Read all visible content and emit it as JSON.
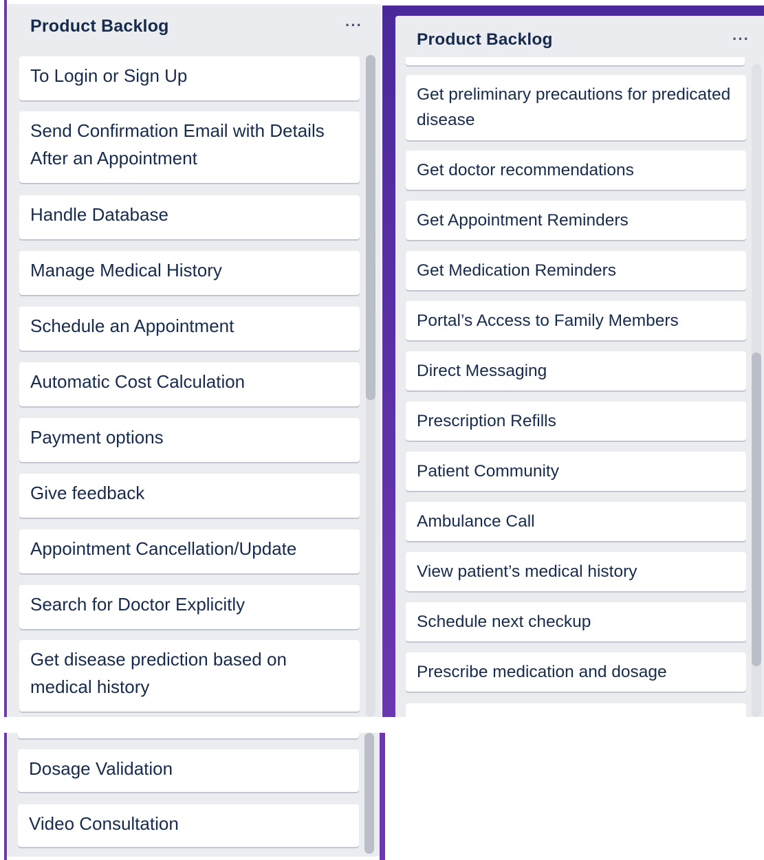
{
  "colors": {
    "board_purple_left": "#6d37ad",
    "board_purple_right": "#5b2fa6",
    "list_bg": "#ebecf0",
    "card_bg": "#ffffff",
    "text": "#172b4d"
  },
  "left_list": {
    "title": "Product Backlog",
    "menu_label": "···",
    "cards": [
      "To Login or Sign Up",
      "Send Confirmation Email with Details After an Appointment",
      "Handle Database",
      "Manage Medical History",
      "Schedule an Appointment",
      "Automatic Cost Calculation",
      "Payment options",
      "Give feedback",
      "Appointment Cancellation/Update",
      "Search for Doctor Explicitly",
      "Get disease prediction based on medical history"
    ]
  },
  "right_list": {
    "title": "Product Backlog",
    "menu_label": "···",
    "cards": [
      "Get preliminary precautions for predicated disease",
      "Get doctor recommendations",
      "Get Appointment Reminders",
      "Get Medication Reminders",
      "Portal’s Access to Family Members",
      "Direct Messaging",
      "Prescription Refills",
      "Patient Community",
      "Ambulance Call",
      "View patient’s medical history",
      "Schedule next checkup",
      "Prescribe medication and dosage"
    ]
  },
  "bottom_list": {
    "cards": [
      "Dosage Validation",
      "Video Consultation"
    ]
  }
}
